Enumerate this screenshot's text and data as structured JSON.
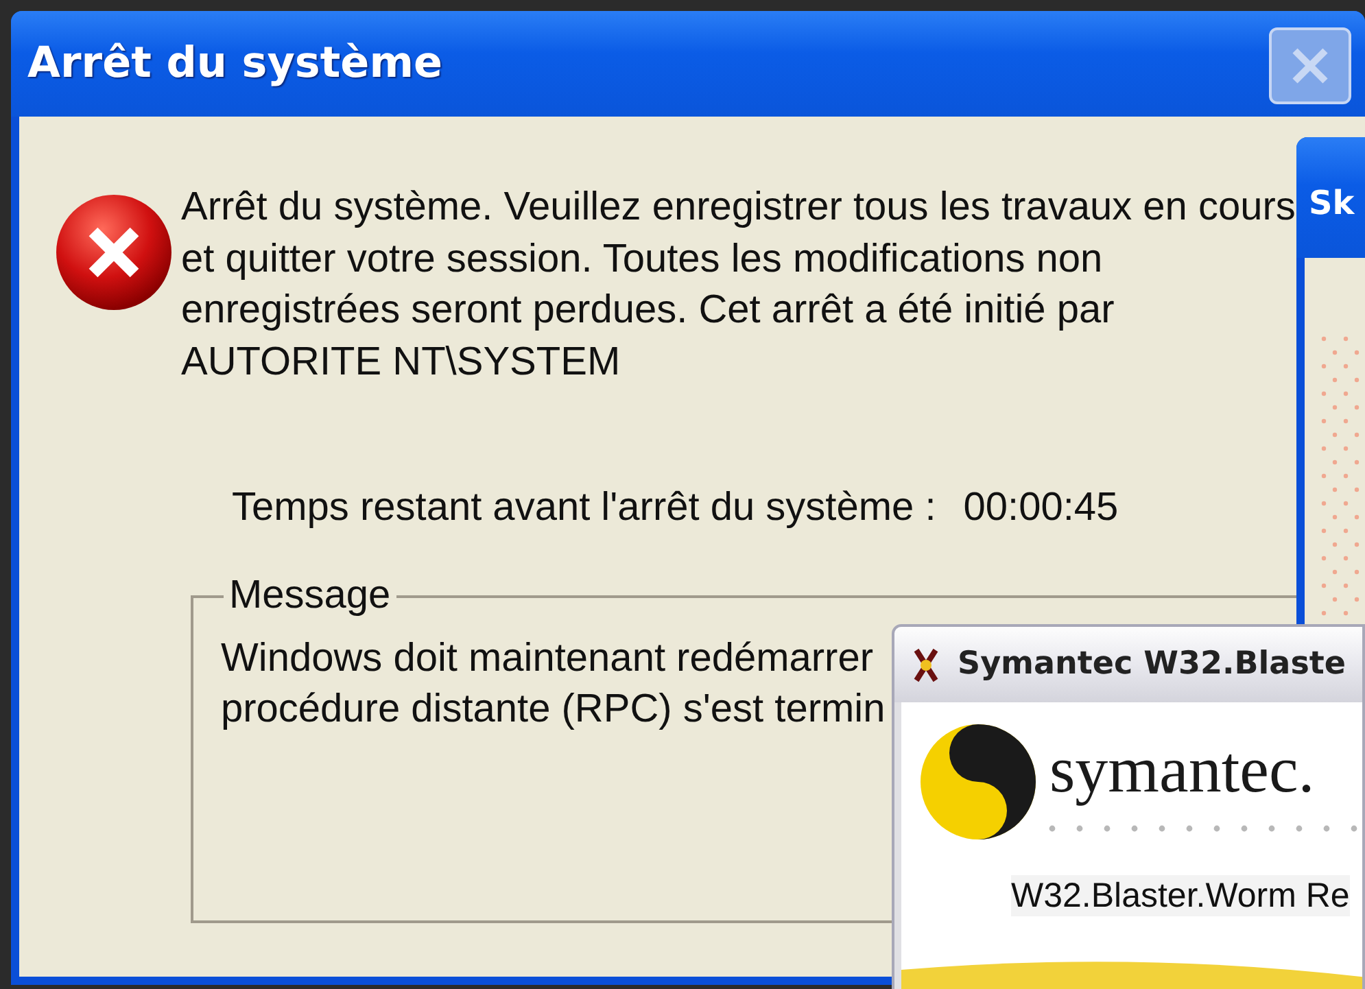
{
  "shutdown_window": {
    "title": "Arrêt du système",
    "close_button": {
      "disabled": true
    },
    "message_lines": [
      "Arrêt du système. Veuillez enregistrer tous les travaux en cours",
      "et quitter votre session. Toutes les modifications non",
      "enregistrées seront perdues. Cet arrêt a été initié par",
      "AUTORITE NT\\SYSTEM"
    ],
    "countdown_label": "Temps restant avant l'arrêt du système :",
    "countdown_value": "00:00:45",
    "message_group": {
      "legend": "Message",
      "lines": [
        "Windows doit maintenant redémarrer",
        "procédure distante (RPC) s'est termin"
      ]
    }
  },
  "background_window": {
    "title": "Sk"
  },
  "symantec_window": {
    "title": "Symantec W32.Blaste",
    "logo_text": "symantec.",
    "body_text": "W32.Blaster.Worm Re"
  }
}
